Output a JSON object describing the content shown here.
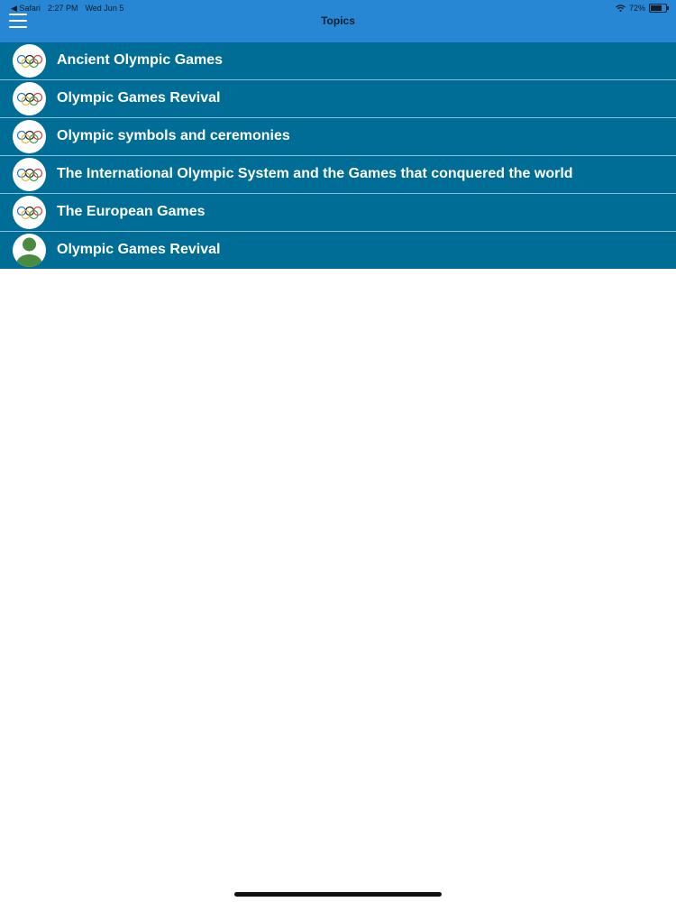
{
  "status_bar": {
    "back_label": "◀ Safari",
    "time": "2:27 PM",
    "date": "Wed Jun 5",
    "battery": "72%",
    "battery_level": 0.72
  },
  "nav": {
    "title": "Topics"
  },
  "topics": [
    {
      "label": "Ancient Olympic Games",
      "icon": "olympic-rings-icon"
    },
    {
      "label": "Olympic Games Revival",
      "icon": "olympic-rings-icon"
    },
    {
      "label": "Olympic symbols and ceremonies",
      "icon": "olympic-rings-icon"
    },
    {
      "label": "The International Olympic System and the Games that conquered the world",
      "icon": "olympic-rings-icon"
    },
    {
      "label": "The European Games",
      "icon": "olympic-rings-icon"
    },
    {
      "label": "Olympic Games Revival",
      "icon": "person-placeholder-icon"
    }
  ],
  "colors": {
    "header": "#2887d4",
    "row": "#006d97",
    "divider": "#8cc2d6",
    "text": "#ffffff",
    "avatar_person": "#4a8c3f",
    "rings": [
      "#1e78c8",
      "#222222",
      "#d43c3c",
      "#e8b82e",
      "#3a9a4a"
    ]
  }
}
